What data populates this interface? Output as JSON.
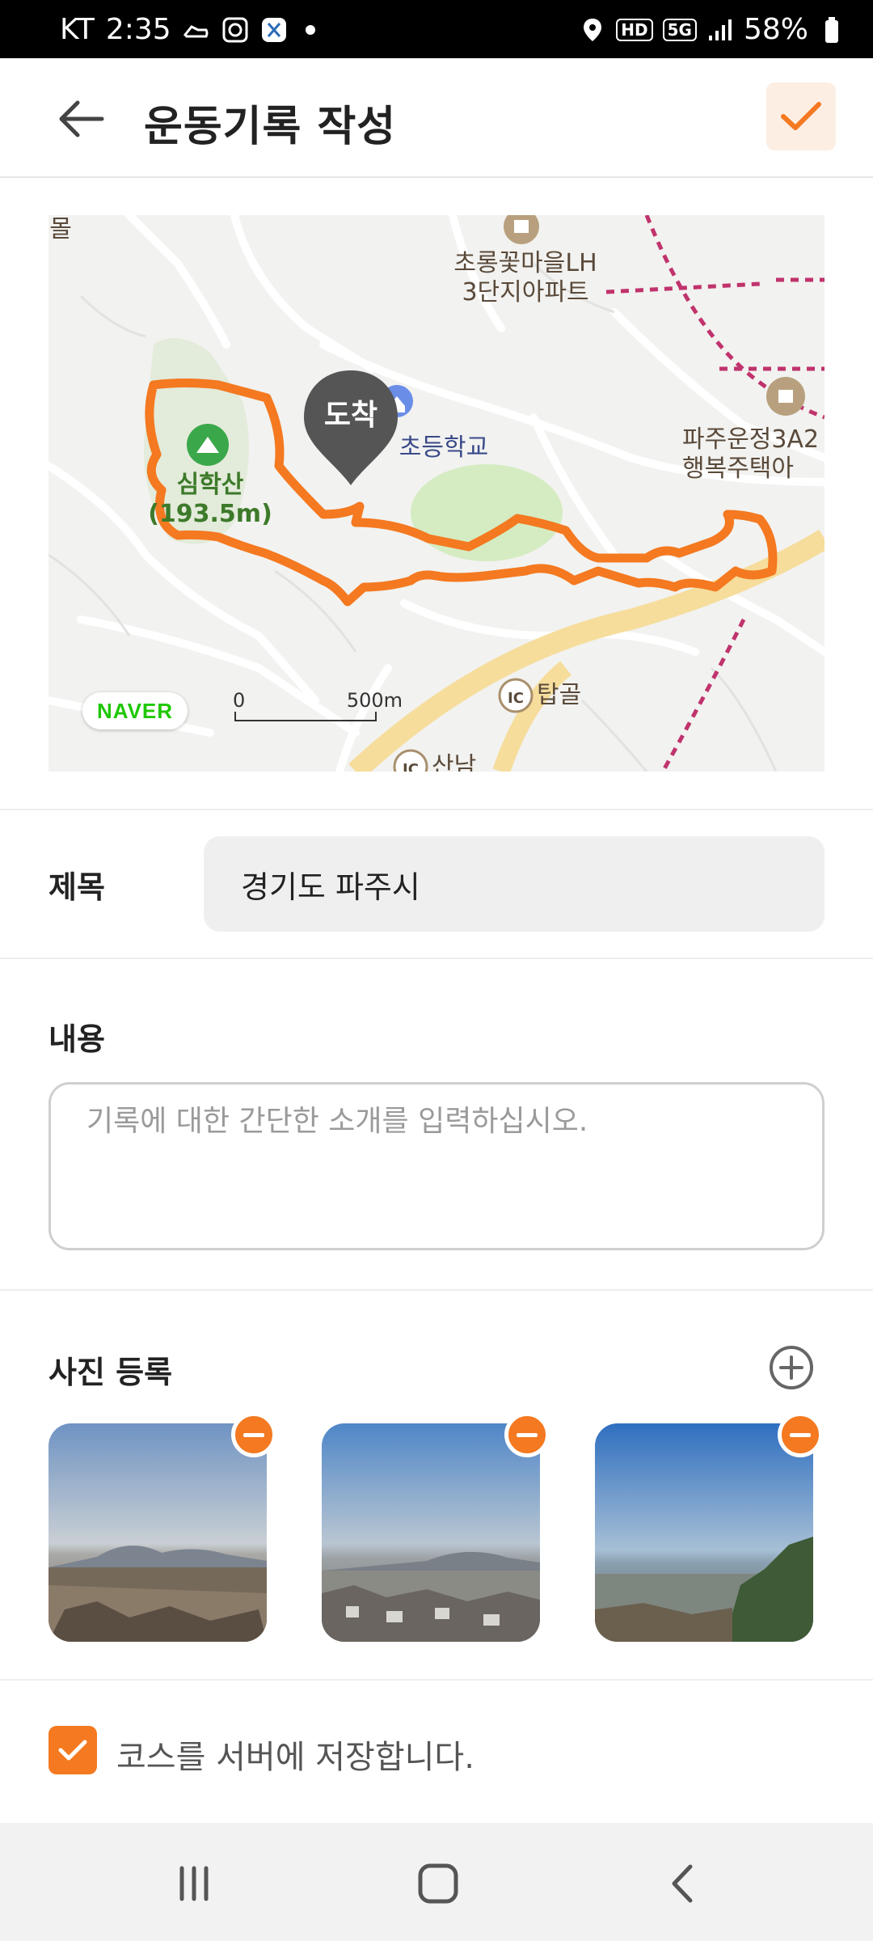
{
  "status_bar": {
    "carrier": "KT",
    "time": "2:35",
    "network_label": "5G",
    "hd_label": "HD",
    "battery": "58%"
  },
  "app_bar": {
    "title": "운동기록 작성",
    "back_icon": "arrow-left-icon",
    "confirm_icon": "checkmark-icon",
    "accent_color": "#f47920"
  },
  "map": {
    "labels": {
      "top_left": "몰",
      "apartment": "초롱꽃마을LH\n3단지아파트",
      "school": "초등학교",
      "mountain": "심학산\n(193.5m)",
      "apartment_right": "파주운정3A2\n행복주택아",
      "ic_tapgol": "탑골",
      "ic_sannam": "산남",
      "ic_badge": "IC"
    },
    "pin_label": "도착",
    "logo": "NAVER",
    "scale_zero": "0",
    "scale_max": "500m",
    "route_color": "#f47920"
  },
  "form": {
    "title_label": "제목",
    "title_value": "경기도 파주시",
    "content_label": "내용",
    "content_placeholder": "기록에 대한 간단한 소개를 입력하십시오.",
    "photos_label": "사진 등록",
    "photos": [
      {
        "name": "photo-1"
      },
      {
        "name": "photo-2"
      },
      {
        "name": "photo-3"
      }
    ],
    "save_course_label": "코스를 서버에 저장합니다.",
    "save_course_checked": true
  },
  "nav_bar": {
    "recent_icon": "recent-apps-icon",
    "home_icon": "home-icon",
    "back_icon": "back-chevron-icon"
  }
}
